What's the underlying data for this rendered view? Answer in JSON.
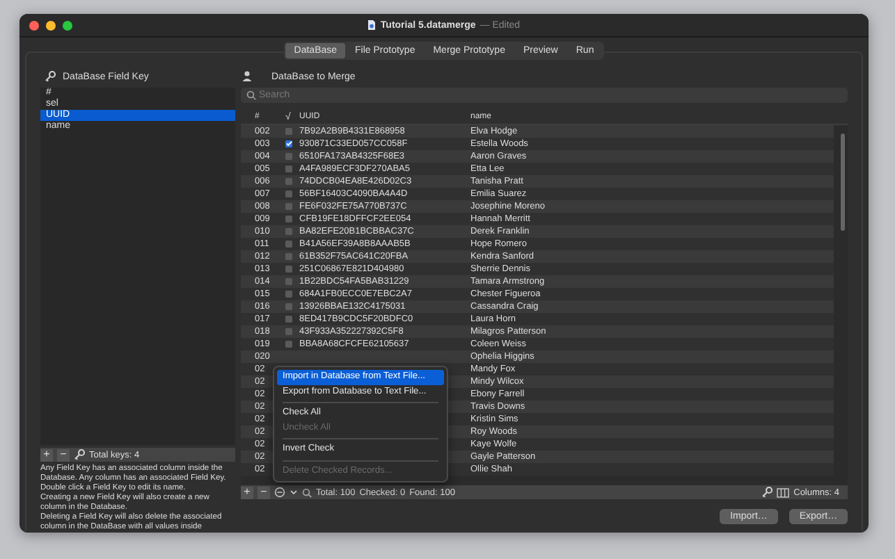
{
  "window": {
    "title": "Tutorial 5.datamerge",
    "edited_label": "— Edited"
  },
  "tabs": [
    {
      "label": "DataBase",
      "selected": true
    },
    {
      "label": "File Prototype",
      "selected": false
    },
    {
      "label": "Merge Prototype",
      "selected": false
    },
    {
      "label": "Preview",
      "selected": false
    },
    {
      "label": "Run",
      "selected": false
    }
  ],
  "field_keys": {
    "title": "DataBase Field Key",
    "items": [
      {
        "label": "#",
        "selected": false
      },
      {
        "label": "sel",
        "selected": false
      },
      {
        "label": "UUID",
        "selected": true
      },
      {
        "label": "name",
        "selected": false
      }
    ],
    "footer": {
      "add": "+",
      "remove": "−",
      "total": "Total keys: 4"
    },
    "help": [
      "Any Field Key has an associated column inside the",
      "Database. Any column has an associated Field Key.",
      "Double click a Field Key to edit its name.",
      "Creating a new Field Key will also create a new",
      "column in the Database.",
      "Deleting a Field Key will also delete the associated",
      "column in the DataBase with all values inside"
    ]
  },
  "database": {
    "title": "DataBase to Merge",
    "search": {
      "placeholder": "Search"
    },
    "columns": [
      "#",
      "√",
      "UUID",
      "name"
    ],
    "rows": [
      {
        "number": "002",
        "checked": false,
        "uuid": "7B92A2B9B4331E868958",
        "name": "Elva Hodge"
      },
      {
        "number": "003",
        "checked": true,
        "uuid": "930871C33ED057CC058F",
        "name": "Estella Woods"
      },
      {
        "number": "004",
        "checked": false,
        "uuid": "6510FA173AB4325F68E3",
        "name": "Aaron Graves"
      },
      {
        "number": "005",
        "checked": false,
        "uuid": "A4FA989ECF3DF270ABA5",
        "name": "Etta Lee"
      },
      {
        "number": "006",
        "checked": false,
        "uuid": "74DDCB04EA8E426D02C3",
        "name": "Tanisha Pratt"
      },
      {
        "number": "007",
        "checked": false,
        "uuid": "56BF16403C4090BA4A4D",
        "name": "Emilia Suarez"
      },
      {
        "number": "008",
        "checked": false,
        "uuid": "FE6F032FE75A770B737C",
        "name": "Josephine Moreno"
      },
      {
        "number": "009",
        "checked": false,
        "uuid": "CFB19FE18DFFCF2EE054",
        "name": "Hannah Merritt"
      },
      {
        "number": "010",
        "checked": false,
        "uuid": "BA82EFE20B1BCBBAC37C",
        "name": "Derek Franklin"
      },
      {
        "number": "011",
        "checked": false,
        "uuid": "B41A56EF39A8B8AAAB5B",
        "name": "Hope Romero"
      },
      {
        "number": "012",
        "checked": false,
        "uuid": "61B352F75AC641C20FBA",
        "name": "Kendra Sanford"
      },
      {
        "number": "013",
        "checked": false,
        "uuid": "251C06867E821D404980",
        "name": "Sherrie Dennis"
      },
      {
        "number": "014",
        "checked": false,
        "uuid": "1B22BDC54FA5BAB31229",
        "name": "Tamara Armstrong"
      },
      {
        "number": "015",
        "checked": false,
        "uuid": "684A1FB0ECC0E7EBC2A7",
        "name": "Chester Figueroa"
      },
      {
        "number": "016",
        "checked": false,
        "uuid": "13926BBAE132C4175031",
        "name": "Cassandra Craig"
      },
      {
        "number": "017",
        "checked": false,
        "uuid": "8ED417B9CDC5F20BDFC0",
        "name": "Laura Horn"
      },
      {
        "number": "018",
        "checked": false,
        "uuid": "43F933A352227392C5F8",
        "name": "Milagros Patterson"
      },
      {
        "number": "019",
        "checked": false,
        "uuid": "BBA8A68CFCFE62105637",
        "name": "Coleen Weiss"
      },
      {
        "number": "020",
        "name": "Ophelia Higgins"
      },
      {
        "number": "02",
        "name": "Mandy Fox"
      },
      {
        "number": "02",
        "name": "Mindy Wilcox"
      },
      {
        "number": "02",
        "name": "Ebony Farrell"
      },
      {
        "number": "02",
        "name": "Travis Downs"
      },
      {
        "number": "02",
        "name": "Kristin Sims"
      },
      {
        "number": "02",
        "name": "Roy Woods"
      },
      {
        "number": "02",
        "name": "Kaye Wolfe"
      },
      {
        "number": "02",
        "name": "Gayle Patterson"
      },
      {
        "number": "02",
        "name": "Ollie Shah"
      }
    ],
    "footer": {
      "add": "+",
      "remove": "−",
      "total": "Total: 100",
      "checked": "Checked: 0",
      "found": "Found: 100",
      "columns": "Columns: 4"
    }
  },
  "context_menu": {
    "items": [
      {
        "kind": "item",
        "label": "Import in Database from Text File...",
        "selected": true,
        "disabled": false
      },
      {
        "kind": "item",
        "label": "Export from Database to Text File...",
        "selected": false,
        "disabled": false
      },
      {
        "kind": "separator"
      },
      {
        "kind": "item",
        "label": "Check All",
        "selected": false,
        "disabled": false
      },
      {
        "kind": "item",
        "label": "Uncheck All",
        "selected": false,
        "disabled": true
      },
      {
        "kind": "separator"
      },
      {
        "kind": "item",
        "label": "Invert Check",
        "selected": false,
        "disabled": false
      },
      {
        "kind": "separator"
      },
      {
        "kind": "item",
        "label": "Delete Checked Records...",
        "selected": false,
        "disabled": true
      }
    ]
  },
  "buttons": [
    "Import…",
    "Export…"
  ]
}
